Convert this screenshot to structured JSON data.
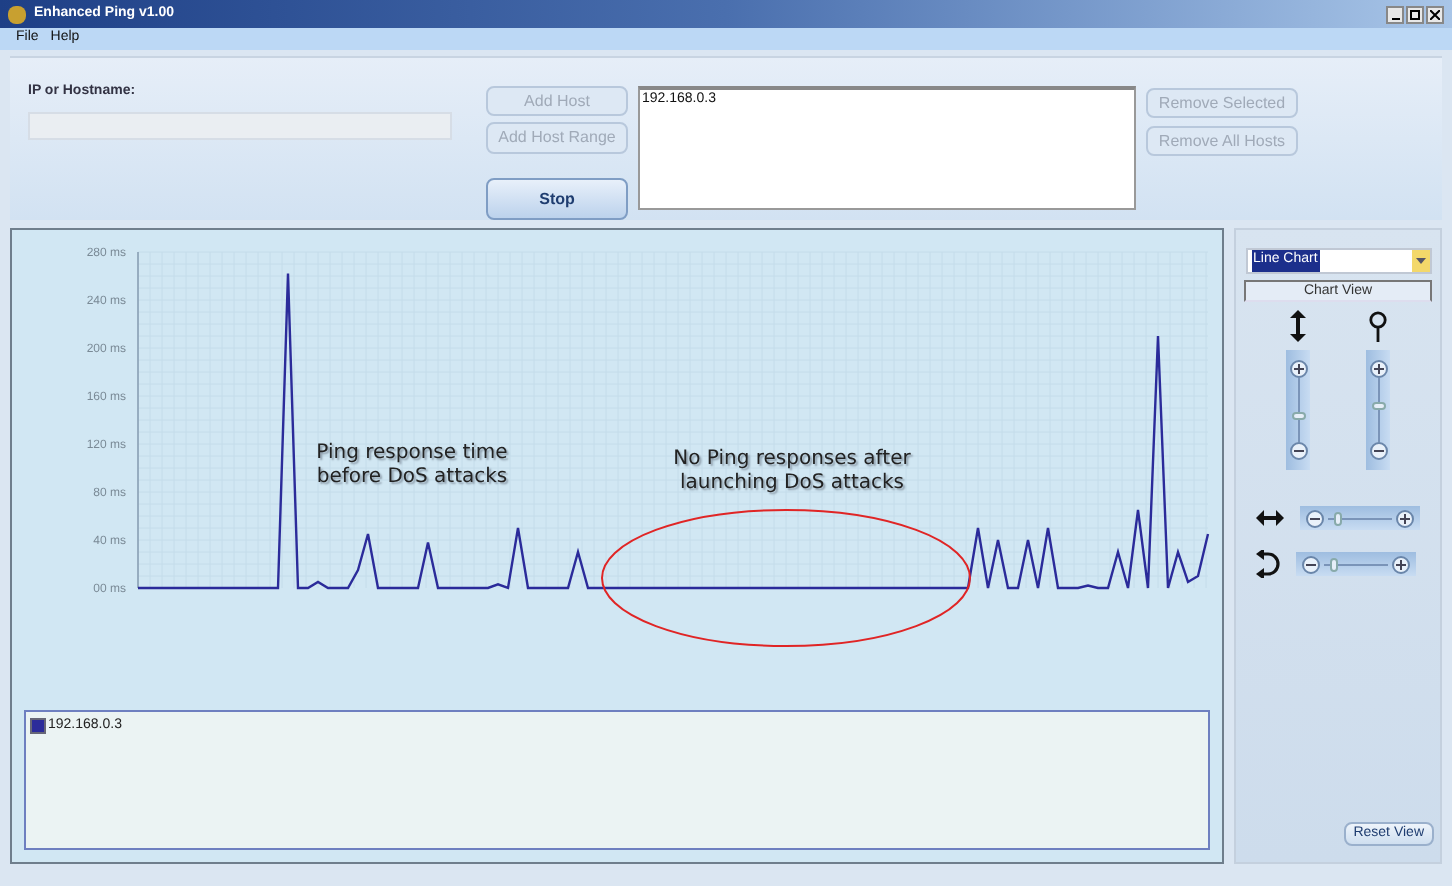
{
  "window": {
    "title": "Enhanced Ping v1.00"
  },
  "menu": [
    "File",
    "Help"
  ],
  "host_input": {
    "label": "IP or Hostname:",
    "disabled": true
  },
  "buttons": [
    {
      "label": "Add Host",
      "disabled": true
    },
    {
      "label": "Add Host Range",
      "disabled": true
    },
    {
      "label": "Stop",
      "disabled": false
    }
  ],
  "hosts": [
    {
      "label": "192.168.0.3",
      "selected": false
    }
  ],
  "remove_buttons": [
    {
      "label": "Remove Selected",
      "disabled": true
    },
    {
      "label": "Remove All Hosts",
      "disabled": true
    }
  ],
  "chart_data": {
    "type": "line",
    "ylim": [
      0,
      280
    ],
    "yticks": [
      {
        "value": 0,
        "label": "00 ms"
      },
      {
        "value": 40,
        "label": "40 ms"
      },
      {
        "value": 80,
        "label": "80 ms"
      },
      {
        "value": 120,
        "label": "120 ms"
      },
      {
        "value": 160,
        "label": "160 ms"
      },
      {
        "value": 200,
        "label": "200 ms"
      },
      {
        "value": 240,
        "label": "240 ms"
      },
      {
        "value": 280,
        "label": "280 ms"
      }
    ],
    "series": [
      {
        "name": "192.168.0.3",
        "color": "#2b2b9a",
        "values": [
          0,
          0,
          0,
          0,
          0,
          0,
          0,
          0,
          0,
          0,
          0,
          0,
          0,
          0,
          0,
          262,
          0,
          0,
          5,
          0,
          0,
          0,
          15,
          45,
          0,
          0,
          0,
          0,
          0,
          38,
          0,
          0,
          0,
          0,
          0,
          0,
          3,
          0,
          50,
          0,
          0,
          0,
          0,
          0,
          30,
          0,
          0,
          0,
          0,
          0,
          0,
          0,
          0,
          0,
          0,
          0,
          0,
          0,
          0,
          0,
          0,
          0,
          0,
          0,
          0,
          0,
          0,
          0,
          0,
          0,
          0,
          0,
          0,
          0,
          0,
          0,
          0,
          0,
          0,
          0,
          0,
          0,
          0,
          0,
          50,
          0,
          40,
          0,
          0,
          40,
          0,
          50,
          0,
          0,
          0,
          2,
          0,
          0,
          30,
          0,
          65,
          0,
          210,
          0,
          30,
          5,
          10,
          45
        ]
      }
    ],
    "grid": true,
    "annotations": [
      {
        "text": "Ping response time before DoS attacks"
      },
      {
        "text": "No Ping responses after launching DoS attacks"
      }
    ]
  },
  "overlay_shapes": [
    {
      "kind": "ellipse"
    }
  ],
  "chart_type": {
    "value": "Line Chart"
  },
  "chart_view": {
    "label": "Chart View"
  },
  "vertical_sliders": [
    {
      "kind": "scale",
      "level": 0.4
    },
    {
      "kind": "zoom",
      "level": 0.55
    }
  ],
  "horizontal_sliders": [
    {
      "kind": "pan",
      "level": 0.15
    },
    {
      "kind": "rotate",
      "level": 0.15
    }
  ],
  "reset_button": {
    "label": "Reset View"
  }
}
